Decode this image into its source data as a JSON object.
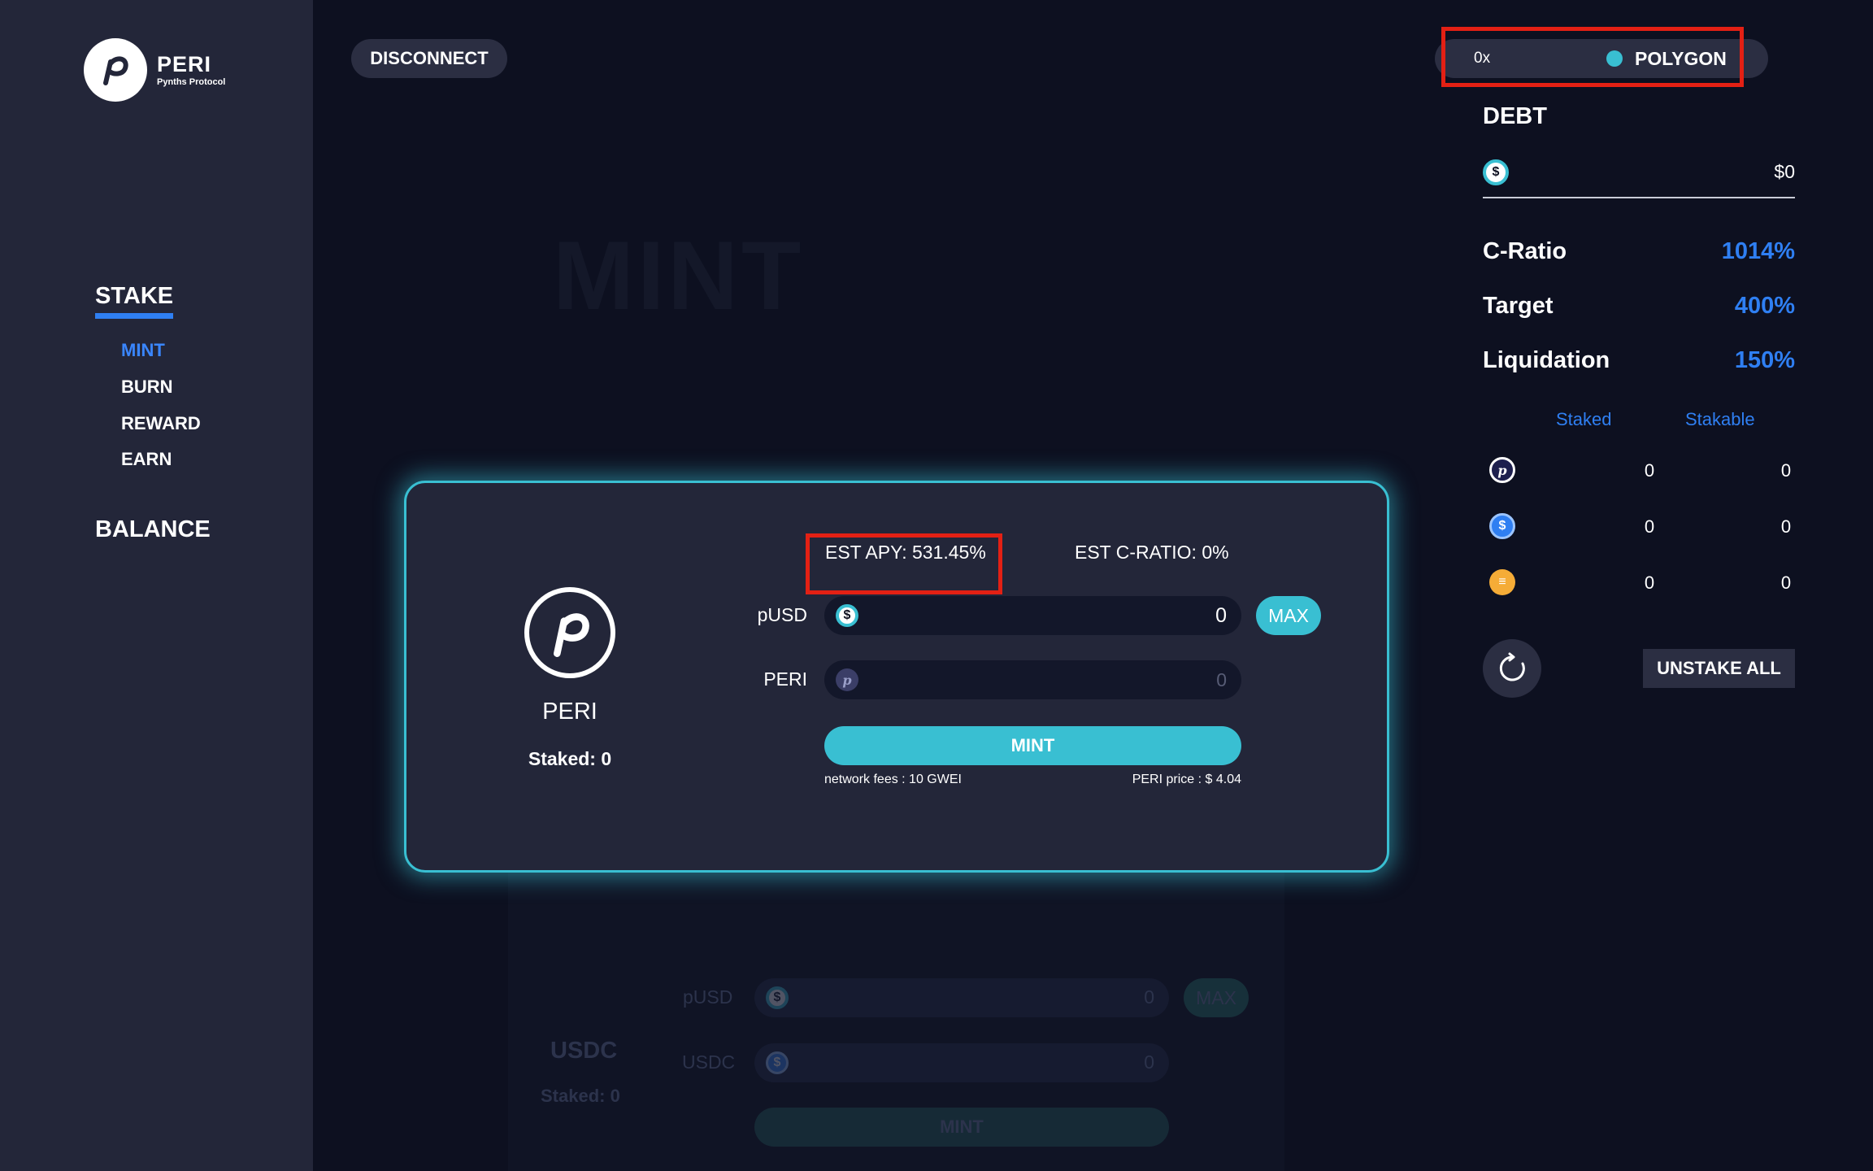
{
  "app": {
    "logo_name": "PERI",
    "logo_subtitle": "Pynths Protocol"
  },
  "sidebar": {
    "section_stake": "STAKE",
    "items": [
      {
        "label": "MINT",
        "active": true
      },
      {
        "label": "BURN",
        "active": false
      },
      {
        "label": "REWARD",
        "active": false
      },
      {
        "label": "EARN",
        "active": false
      }
    ],
    "section_balance": "BALANCE"
  },
  "header": {
    "disconnect_label": "DISCONNECT",
    "address": "0x",
    "network": "POLYGON",
    "network_color": "#39bfd2"
  },
  "page": {
    "title": "MINT"
  },
  "mint_card": {
    "token_name": "PERI",
    "staked_text": "Staked: 0",
    "est_apy": "EST APY: 531.45%",
    "est_cratio": "EST C-RATIO: 0%",
    "pusd_label": "pUSD",
    "pusd_value": "0",
    "peri_label": "PERI",
    "peri_value": "0",
    "max_label": "MAX",
    "mint_label": "MINT",
    "network_fees": "network fees : 10 GWEI",
    "peri_price": "PERI price : $ 4.04"
  },
  "bg_card": {
    "token_name": "USDC",
    "staked_text": "Staked: 0",
    "pusd_label": "pUSD",
    "usdc_label": "USDC",
    "pusd_value": "0",
    "usdc_value": "0",
    "max_label": "MAX",
    "mint_label": "MINT"
  },
  "right_panel": {
    "debt_title": "DEBT",
    "debt_value": "$0",
    "c_ratio_label": "C-Ratio",
    "c_ratio_value": "1014%",
    "target_label": "Target",
    "target_value": "400%",
    "liquidation_label": "Liquidation",
    "liquidation_value": "150%",
    "col_staked": "Staked",
    "col_stakable": "Stakable",
    "rows": [
      {
        "icon": "peri-coin-icon",
        "staked": "0",
        "stakable": "0"
      },
      {
        "icon": "usdc-coin-icon",
        "staked": "0",
        "stakable": "0"
      },
      {
        "icon": "dai-coin-icon",
        "staked": "0",
        "stakable": "0"
      }
    ],
    "unstake_all_label": "UNSTAKE ALL"
  },
  "colors": {
    "accent": "#39bfd2",
    "blue": "#2f7ff2",
    "highlight": "#e32014"
  }
}
